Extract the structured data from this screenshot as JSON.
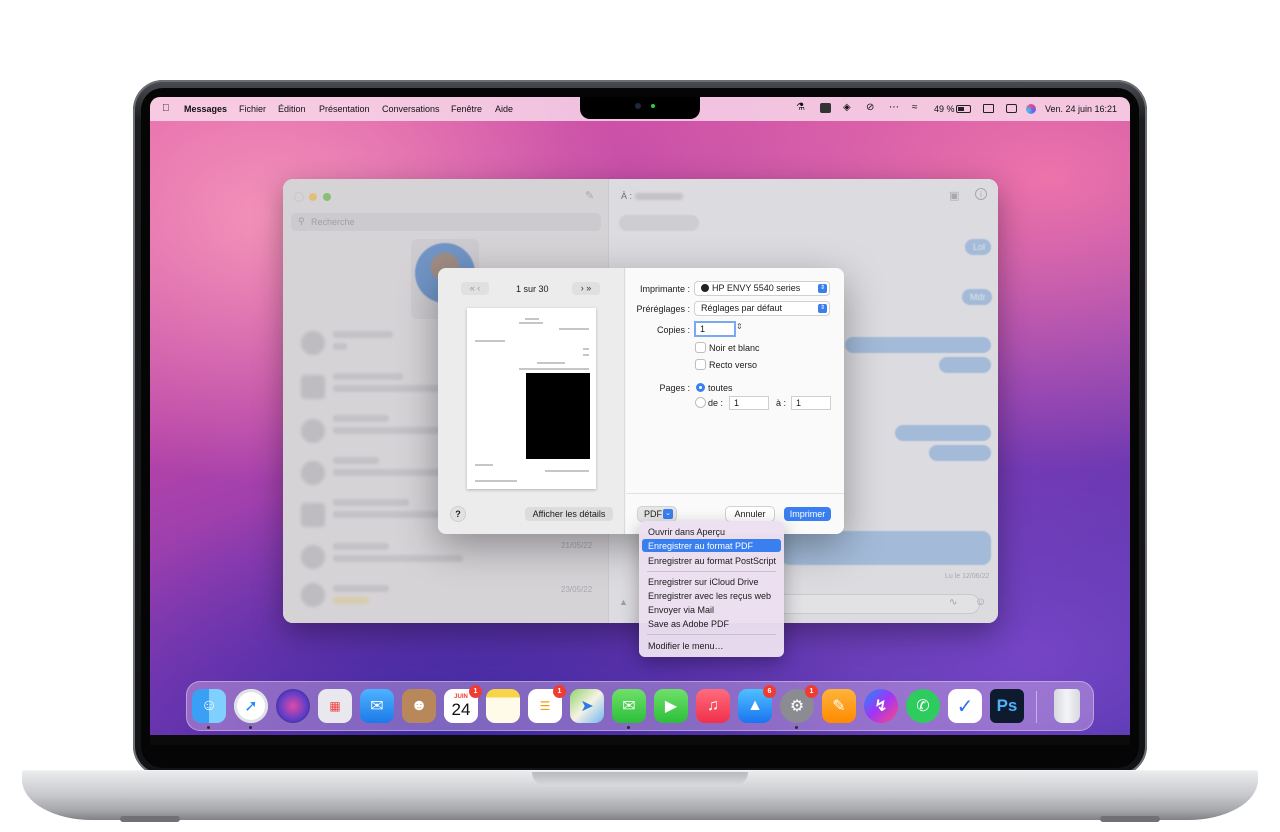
{
  "menubar": {
    "app_name": "Messages",
    "items": [
      "Fichier",
      "Édition",
      "Présentation",
      "Conversations",
      "Fenêtre",
      "Aide"
    ],
    "battery": "49 %",
    "datetime": "Ven. 24 juin  16:21"
  },
  "messages": {
    "recipient_label": "À :",
    "search_placeholder": "Recherche",
    "bubbles": [
      "Lol",
      "Mdr"
    ],
    "dates": [
      "21/05/22",
      "23/05/22"
    ],
    "read_receipt": "Lu le 12/06/22"
  },
  "print": {
    "page_counter": "1 sur 30",
    "printer_label": "Imprimante :",
    "printer_value": "HP ENVY 5540 series",
    "presets_label": "Préréglages :",
    "presets_value": "Réglages par défaut",
    "copies_label": "Copies :",
    "copies_value": "1",
    "bw_label": "Noir et blanc",
    "duplex_label": "Recto verso",
    "pages_label": "Pages :",
    "pages_all_label": "toutes",
    "pages_from_label": "de :",
    "pages_from_value": "1",
    "pages_to_label": "à :",
    "pages_to_value": "1",
    "help_label": "?",
    "details_label": "Afficher les détails",
    "pdf_label": "PDF",
    "cancel_label": "Annuler",
    "print_label": "Imprimer"
  },
  "pdf_menu": {
    "items": [
      "Ouvrir dans Aperçu",
      "Enregistrer au format PDF",
      "Enregistrer au format PostScript",
      "Enregistrer sur iCloud Drive",
      "Enregistrer avec les reçus web",
      "Envoyer via Mail",
      "Save as Adobe PDF",
      "Modifier le menu…"
    ],
    "highlighted": "Enregistrer au format PDF"
  },
  "dock": {
    "calendar_month": "JUIN",
    "calendar_day": "24",
    "photoshop_label": "Ps",
    "badges": {
      "calendar": "1",
      "reminders": "1",
      "appstore": "6",
      "settings": "1"
    }
  },
  "colors": {
    "accent": "#3a7ff0",
    "badge": "#f03b30"
  }
}
